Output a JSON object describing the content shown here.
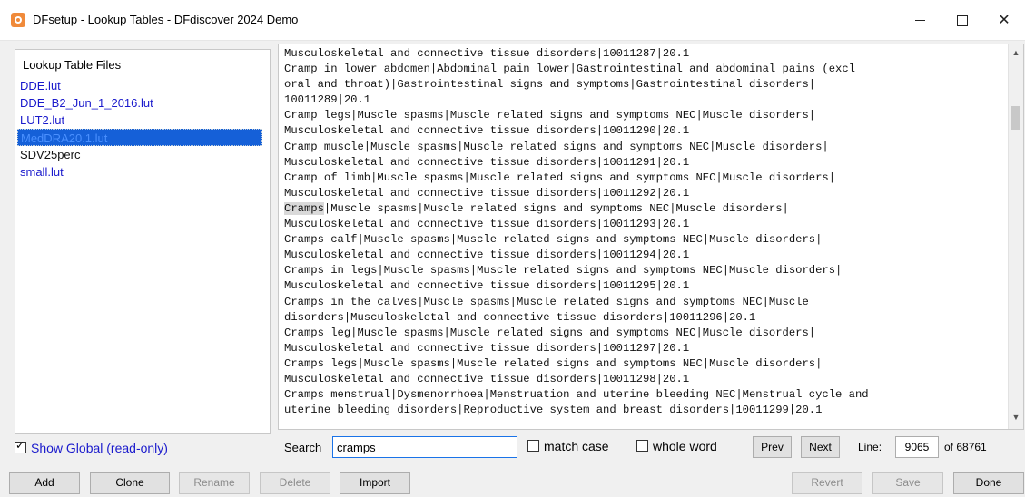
{
  "window": {
    "title": "DFsetup - Lookup Tables - DFdiscover 2024 Demo"
  },
  "left_panel": {
    "header": "Lookup Table Files",
    "files": [
      "DDE.lut",
      "DDE_B2_Jun_1_2016.lut",
      "LUT2.lut",
      "MedDRA20.1.lut",
      "SDV25perc",
      "small.lut"
    ],
    "selected": "MedDRA20.1.lut",
    "show_global_label": "Show Global (read-only)",
    "show_global_checked": true
  },
  "content": {
    "lines": [
      "Musculoskeletal and connective tissue disorders|10011287|20.1",
      "Cramp in lower abdomen|Abdominal pain lower|Gastrointestinal and abdominal pains (excl",
      "oral and throat)|Gastrointestinal signs and symptoms|Gastrointestinal disorders|",
      "10011289|20.1",
      "Cramp legs|Muscle spasms|Muscle related signs and symptoms NEC|Muscle disorders|",
      "Musculoskeletal and connective tissue disorders|10011290|20.1",
      "Cramp muscle|Muscle spasms|Muscle related signs and symptoms NEC|Muscle disorders|",
      "Musculoskeletal and connective tissue disorders|10011291|20.1",
      "Cramp of limb|Muscle spasms|Muscle related signs and symptoms NEC|Muscle disorders|",
      "Musculoskeletal and connective tissue disorders|10011292|20.1",
      "Cramps|Muscle spasms|Muscle related signs and symptoms NEC|Muscle disorders|",
      "Musculoskeletal and connective tissue disorders|10011293|20.1",
      "Cramps calf|Muscle spasms|Muscle related signs and symptoms NEC|Muscle disorders|",
      "Musculoskeletal and connective tissue disorders|10011294|20.1",
      "Cramps in legs|Muscle spasms|Muscle related signs and symptoms NEC|Muscle disorders|",
      "Musculoskeletal and connective tissue disorders|10011295|20.1",
      "Cramps in the calves|Muscle spasms|Muscle related signs and symptoms NEC|Muscle",
      "disorders|Musculoskeletal and connective tissue disorders|10011296|20.1",
      "Cramps leg|Muscle spasms|Muscle related signs and symptoms NEC|Muscle disorders|",
      "Musculoskeletal and connective tissue disorders|10011297|20.1",
      "Cramps legs|Muscle spasms|Muscle related signs and symptoms NEC|Muscle disorders|",
      "Musculoskeletal and connective tissue disorders|10011298|20.1",
      "Cramps menstrual|Dysmenorrhoea|Menstruation and uterine bleeding NEC|Menstrual cycle and",
      "uterine bleeding disorders|Reproductive system and breast disorders|10011299|20.1"
    ],
    "highlight_word": "Cramps"
  },
  "search": {
    "label": "Search",
    "value": "cramps",
    "match_case_label": "match case",
    "whole_word_label": "whole word",
    "prev_label": "Prev",
    "next_label": "Next",
    "line_label": "Line:",
    "line_value": "9065",
    "total_label": "of 68761"
  },
  "buttons": {
    "add": "Add",
    "clone": "Clone",
    "rename": "Rename",
    "delete": "Delete",
    "import": "Import",
    "revert": "Revert",
    "save": "Save",
    "done": "Done"
  }
}
